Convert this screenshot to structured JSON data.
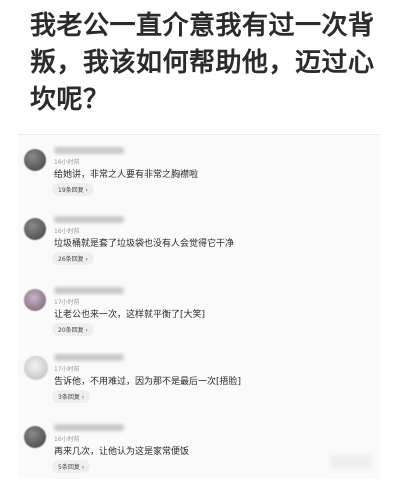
{
  "question": "我老公一直介意我有过一次背叛，我该如何帮助他，迈过心坎呢？",
  "comments": [
    {
      "time": "16小时前",
      "text": "给她讲，非常之人要有非常之胸襟啦",
      "replies": "19条回复 ›"
    },
    {
      "time": "16小时前",
      "text": "垃圾桶就是套了垃圾袋也没有人会觉得它干净",
      "replies": "26条回复 ›"
    },
    {
      "time": "17小时前",
      "text": "让老公也来一次，这样就平衡了[大笑]",
      "replies": "20条回复 ›"
    },
    {
      "time": "17小时前",
      "text": "告诉他，不用难过，因为那不是最后一次[捂脸]",
      "replies": "3条回复 ›"
    },
    {
      "time": "16小时前",
      "text": "再来几次，让他认为这是家常便饭",
      "replies": "5条回复 ›"
    }
  ]
}
